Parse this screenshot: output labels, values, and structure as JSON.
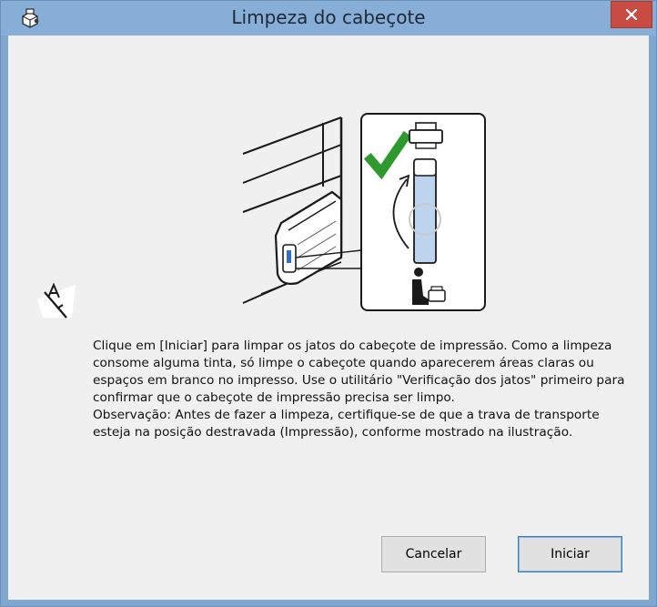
{
  "window": {
    "title": "Limpeza do cabeçote"
  },
  "icons": {
    "title": "printer-icon",
    "close": "close-icon",
    "tool": "auto-tool-icon",
    "illustration": "print-head-lock-illustration"
  },
  "content": {
    "paragraph1": "Clique em [Iniciar] para limpar os jatos do cabeçote de impressão. Como a limpeza consome alguma tinta, só limpe o cabeçote quando aparecerem áreas claras ou espaços em branco no impresso. Use o utilitário \"Verificação dos jatos\" primeiro para confirmar que o cabeçote de impressão precisa ser limpo.",
    "paragraph2": "Observação: Antes de fazer a limpeza, certifique-se de que a trava de transporte esteja na posição destravada (Impressão), conforme mostrado na ilustração."
  },
  "buttons": {
    "cancel": "Cancelar",
    "start": "Iniciar"
  },
  "colors": {
    "titlebar": "#87aed6",
    "close": "#c94c43",
    "check": "#2e9a2e",
    "background": "#f0f0f0"
  }
}
